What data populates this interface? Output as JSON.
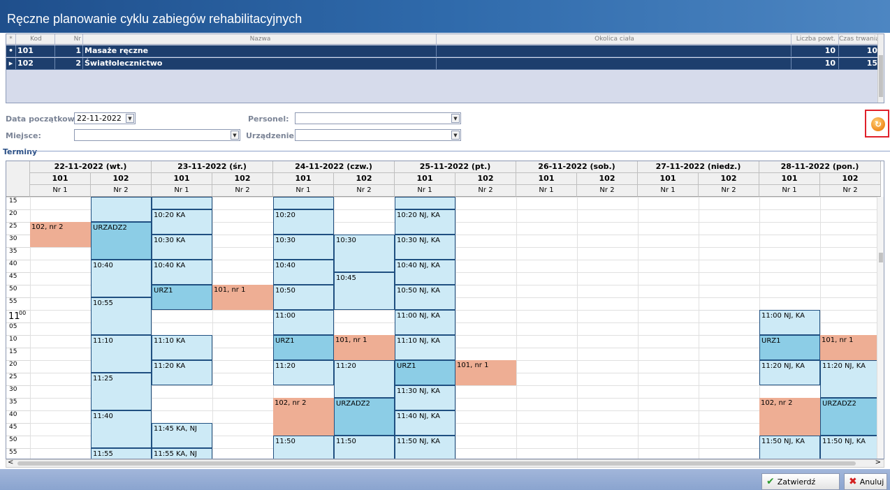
{
  "window": {
    "title": "Ręczne planowanie cyklu zabiegów rehabilitacyjnych"
  },
  "top_table": {
    "columns": [
      "*",
      "Kod",
      "Nr",
      "Nazwa",
      "Okolica ciała",
      "Liczba powt.",
      "Czas trwania"
    ],
    "rows": [
      {
        "marker": "•",
        "kod": "101",
        "nr": "1",
        "nazwa": "Masaże ręczne",
        "okolica": "",
        "liczba": "10",
        "czas": "10"
      },
      {
        "marker": "▸",
        "kod": "102",
        "nr": "2",
        "nazwa": "Światłolecznictwo",
        "okolica": "",
        "liczba": "10",
        "czas": "15"
      }
    ]
  },
  "filters": {
    "data_label": "Data początkowa:",
    "data_value": "22-11-2022",
    "personel_label": "Personel:",
    "personel_value": "",
    "miejsce_label": "Miejsce:",
    "miejsce_value": "",
    "urzadzenie_label": "Urządzenie:",
    "urzadzenie_value": ""
  },
  "terminy_label": "Terminy",
  "days": [
    {
      "label": "22-11-2022 (wt.)",
      "cols": [
        "101",
        "102"
      ],
      "nrs": [
        "Nr 1",
        "Nr 2"
      ]
    },
    {
      "label": "23-11-2022 (śr.)",
      "cols": [
        "101",
        "102"
      ],
      "nrs": [
        "Nr 1",
        "Nr 2"
      ]
    },
    {
      "label": "24-11-2022 (czw.)",
      "cols": [
        "101",
        "102"
      ],
      "nrs": [
        "Nr 1",
        "Nr 2"
      ]
    },
    {
      "label": "25-11-2022 (pt.)",
      "cols": [
        "101",
        "102"
      ],
      "nrs": [
        "Nr 1",
        "Nr 2"
      ]
    },
    {
      "label": "26-11-2022 (sob.)",
      "cols": [
        "101",
        "102"
      ],
      "nrs": [
        "Nr 1",
        "Nr 2"
      ]
    },
    {
      "label": "27-11-2022 (niedz.)",
      "cols": [
        "101",
        "102"
      ],
      "nrs": [
        "Nr 1",
        "Nr 2"
      ]
    },
    {
      "label": "28-11-2022 (pon.)",
      "cols": [
        "101",
        "102"
      ],
      "nrs": [
        "Nr 1",
        "Nr 2"
      ]
    }
  ],
  "time_rows": [
    {
      "m": "15"
    },
    {
      "m": "20"
    },
    {
      "m": "25"
    },
    {
      "m": "30"
    },
    {
      "m": "35"
    },
    {
      "m": "40"
    },
    {
      "m": "45"
    },
    {
      "m": "50"
    },
    {
      "m": "55"
    },
    {
      "h": "11",
      "m": "00"
    },
    {
      "m": "05"
    },
    {
      "m": "10"
    },
    {
      "m": "15"
    },
    {
      "m": "20"
    },
    {
      "m": "25"
    },
    {
      "m": "30"
    },
    {
      "m": "35"
    },
    {
      "m": "40"
    },
    {
      "m": "45"
    },
    {
      "m": "50"
    },
    {
      "m": "55"
    }
  ],
  "events": [
    {
      "col": 0,
      "start": 2,
      "span": 2,
      "text": "102, nr 2",
      "kind": "salmon"
    },
    {
      "col": 1,
      "start": 0,
      "span": 2,
      "text": "",
      "kind": "light"
    },
    {
      "col": 1,
      "start": 2,
      "span": 3,
      "text": "URZADZ2",
      "kind": "dark"
    },
    {
      "col": 1,
      "start": 5,
      "span": 3,
      "text": "10:40",
      "kind": "light"
    },
    {
      "col": 1,
      "start": 8,
      "span": 3,
      "text": "10:55",
      "kind": "light"
    },
    {
      "col": 1,
      "start": 11,
      "span": 3,
      "text": "11:10",
      "kind": "light"
    },
    {
      "col": 1,
      "start": 14,
      "span": 3,
      "text": "11:25",
      "kind": "light"
    },
    {
      "col": 1,
      "start": 17,
      "span": 3,
      "text": "11:40",
      "kind": "light"
    },
    {
      "col": 1,
      "start": 20,
      "span": 2,
      "text": "11:55",
      "kind": "light"
    },
    {
      "col": 2,
      "start": 0,
      "span": 1,
      "text": "",
      "kind": "light"
    },
    {
      "col": 2,
      "start": 1,
      "span": 2,
      "text": "10:20 KA",
      "kind": "light"
    },
    {
      "col": 2,
      "start": 3,
      "span": 2,
      "text": "10:30 KA",
      "kind": "light"
    },
    {
      "col": 2,
      "start": 5,
      "span": 2,
      "text": "10:40 KA",
      "kind": "light"
    },
    {
      "col": 2,
      "start": 7,
      "span": 2,
      "text": "URZ1",
      "kind": "dark"
    },
    {
      "col": 2,
      "start": 11,
      "span": 2,
      "text": "11:10 KA",
      "kind": "light"
    },
    {
      "col": 2,
      "start": 13,
      "span": 2,
      "text": "11:20 KA",
      "kind": "light"
    },
    {
      "col": 2,
      "start": 18,
      "span": 2,
      "text": "11:45 KA, NJ",
      "kind": "light"
    },
    {
      "col": 2,
      "start": 20,
      "span": 2,
      "text": "11:55 KA, NJ",
      "kind": "light"
    },
    {
      "col": 3,
      "start": 7,
      "span": 2,
      "text": "101, nr 1",
      "kind": "salmon"
    },
    {
      "col": 4,
      "start": 0,
      "span": 1,
      "text": "",
      "kind": "light"
    },
    {
      "col": 4,
      "start": 1,
      "span": 2,
      "text": "10:20",
      "kind": "light"
    },
    {
      "col": 4,
      "start": 3,
      "span": 2,
      "text": "10:30",
      "kind": "light"
    },
    {
      "col": 4,
      "start": 5,
      "span": 2,
      "text": "10:40",
      "kind": "light"
    },
    {
      "col": 4,
      "start": 7,
      "span": 2,
      "text": "10:50",
      "kind": "light"
    },
    {
      "col": 4,
      "start": 9,
      "span": 2,
      "text": "11:00",
      "kind": "light"
    },
    {
      "col": 4,
      "start": 11,
      "span": 2,
      "text": "URZ1",
      "kind": "dark"
    },
    {
      "col": 4,
      "start": 13,
      "span": 2,
      "text": "11:20",
      "kind": "light"
    },
    {
      "col": 4,
      "start": 16,
      "span": 3,
      "text": "102, nr 2",
      "kind": "salmon"
    },
    {
      "col": 4,
      "start": 19,
      "span": 2,
      "text": "11:50",
      "kind": "light"
    },
    {
      "col": 5,
      "start": 3,
      "span": 3,
      "text": "10:30",
      "kind": "light"
    },
    {
      "col": 5,
      "start": 6,
      "span": 3,
      "text": "10:45",
      "kind": "light"
    },
    {
      "col": 5,
      "start": 11,
      "span": 2,
      "text": "101, nr 1",
      "kind": "salmon"
    },
    {
      "col": 5,
      "start": 13,
      "span": 3,
      "text": "11:20",
      "kind": "light"
    },
    {
      "col": 5,
      "start": 16,
      "span": 3,
      "text": "URZADZ2",
      "kind": "dark"
    },
    {
      "col": 5,
      "start": 19,
      "span": 2,
      "text": "11:50",
      "kind": "light"
    },
    {
      "col": 6,
      "start": 0,
      "span": 1,
      "text": "",
      "kind": "light"
    },
    {
      "col": 6,
      "start": 1,
      "span": 2,
      "text": "10:20 NJ, KA",
      "kind": "light"
    },
    {
      "col": 6,
      "start": 3,
      "span": 2,
      "text": "10:30 NJ, KA",
      "kind": "light"
    },
    {
      "col": 6,
      "start": 5,
      "span": 2,
      "text": "10:40 NJ, KA",
      "kind": "light"
    },
    {
      "col": 6,
      "start": 7,
      "span": 2,
      "text": "10:50 NJ, KA",
      "kind": "light"
    },
    {
      "col": 6,
      "start": 9,
      "span": 2,
      "text": "11:00 NJ, KA",
      "kind": "light"
    },
    {
      "col": 6,
      "start": 11,
      "span": 2,
      "text": "11:10 NJ, KA",
      "kind": "light"
    },
    {
      "col": 6,
      "start": 13,
      "span": 2,
      "text": "URZ1",
      "kind": "dark"
    },
    {
      "col": 6,
      "start": 15,
      "span": 2,
      "text": "11:30 NJ, KA",
      "kind": "light"
    },
    {
      "col": 6,
      "start": 17,
      "span": 2,
      "text": "11:40 NJ, KA",
      "kind": "light"
    },
    {
      "col": 6,
      "start": 19,
      "span": 2,
      "text": "11:50 NJ, KA",
      "kind": "light"
    },
    {
      "col": 7,
      "start": 13,
      "span": 2,
      "text": "101, nr 1",
      "kind": "salmon"
    },
    {
      "col": 12,
      "start": 9,
      "span": 2,
      "text": "11:00 NJ, KA",
      "kind": "light"
    },
    {
      "col": 12,
      "start": 11,
      "span": 2,
      "text": "URZ1",
      "kind": "dark"
    },
    {
      "col": 12,
      "start": 13,
      "span": 2,
      "text": "11:20 NJ, KA",
      "kind": "light"
    },
    {
      "col": 12,
      "start": 16,
      "span": 3,
      "text": "102, nr 2",
      "kind": "salmon"
    },
    {
      "col": 12,
      "start": 19,
      "span": 2,
      "text": "11:50 NJ, KA",
      "kind": "light"
    },
    {
      "col": 13,
      "start": 11,
      "span": 2,
      "text": "101, nr 1",
      "kind": "salmon"
    },
    {
      "col": 13,
      "start": 13,
      "span": 3,
      "text": "11:20 NJ, KA",
      "kind": "light"
    },
    {
      "col": 13,
      "start": 16,
      "span": 3,
      "text": "URZADZ2",
      "kind": "dark"
    },
    {
      "col": 13,
      "start": 19,
      "span": 2,
      "text": "11:50 NJ, KA",
      "kind": "light"
    }
  ],
  "buttons": {
    "confirm": "Zatwierdź",
    "cancel": "Anuluj"
  },
  "colors": {
    "title_bar": "#1f4f8c",
    "event_light": "#cdeaf6",
    "event_dark": "#8ccde6",
    "event_salmon": "#eeae94",
    "highlight_box": "#e0202a"
  },
  "icons": {
    "refresh": "refresh-icon",
    "confirm": "checkmark-icon",
    "cancel": "x-icon"
  }
}
